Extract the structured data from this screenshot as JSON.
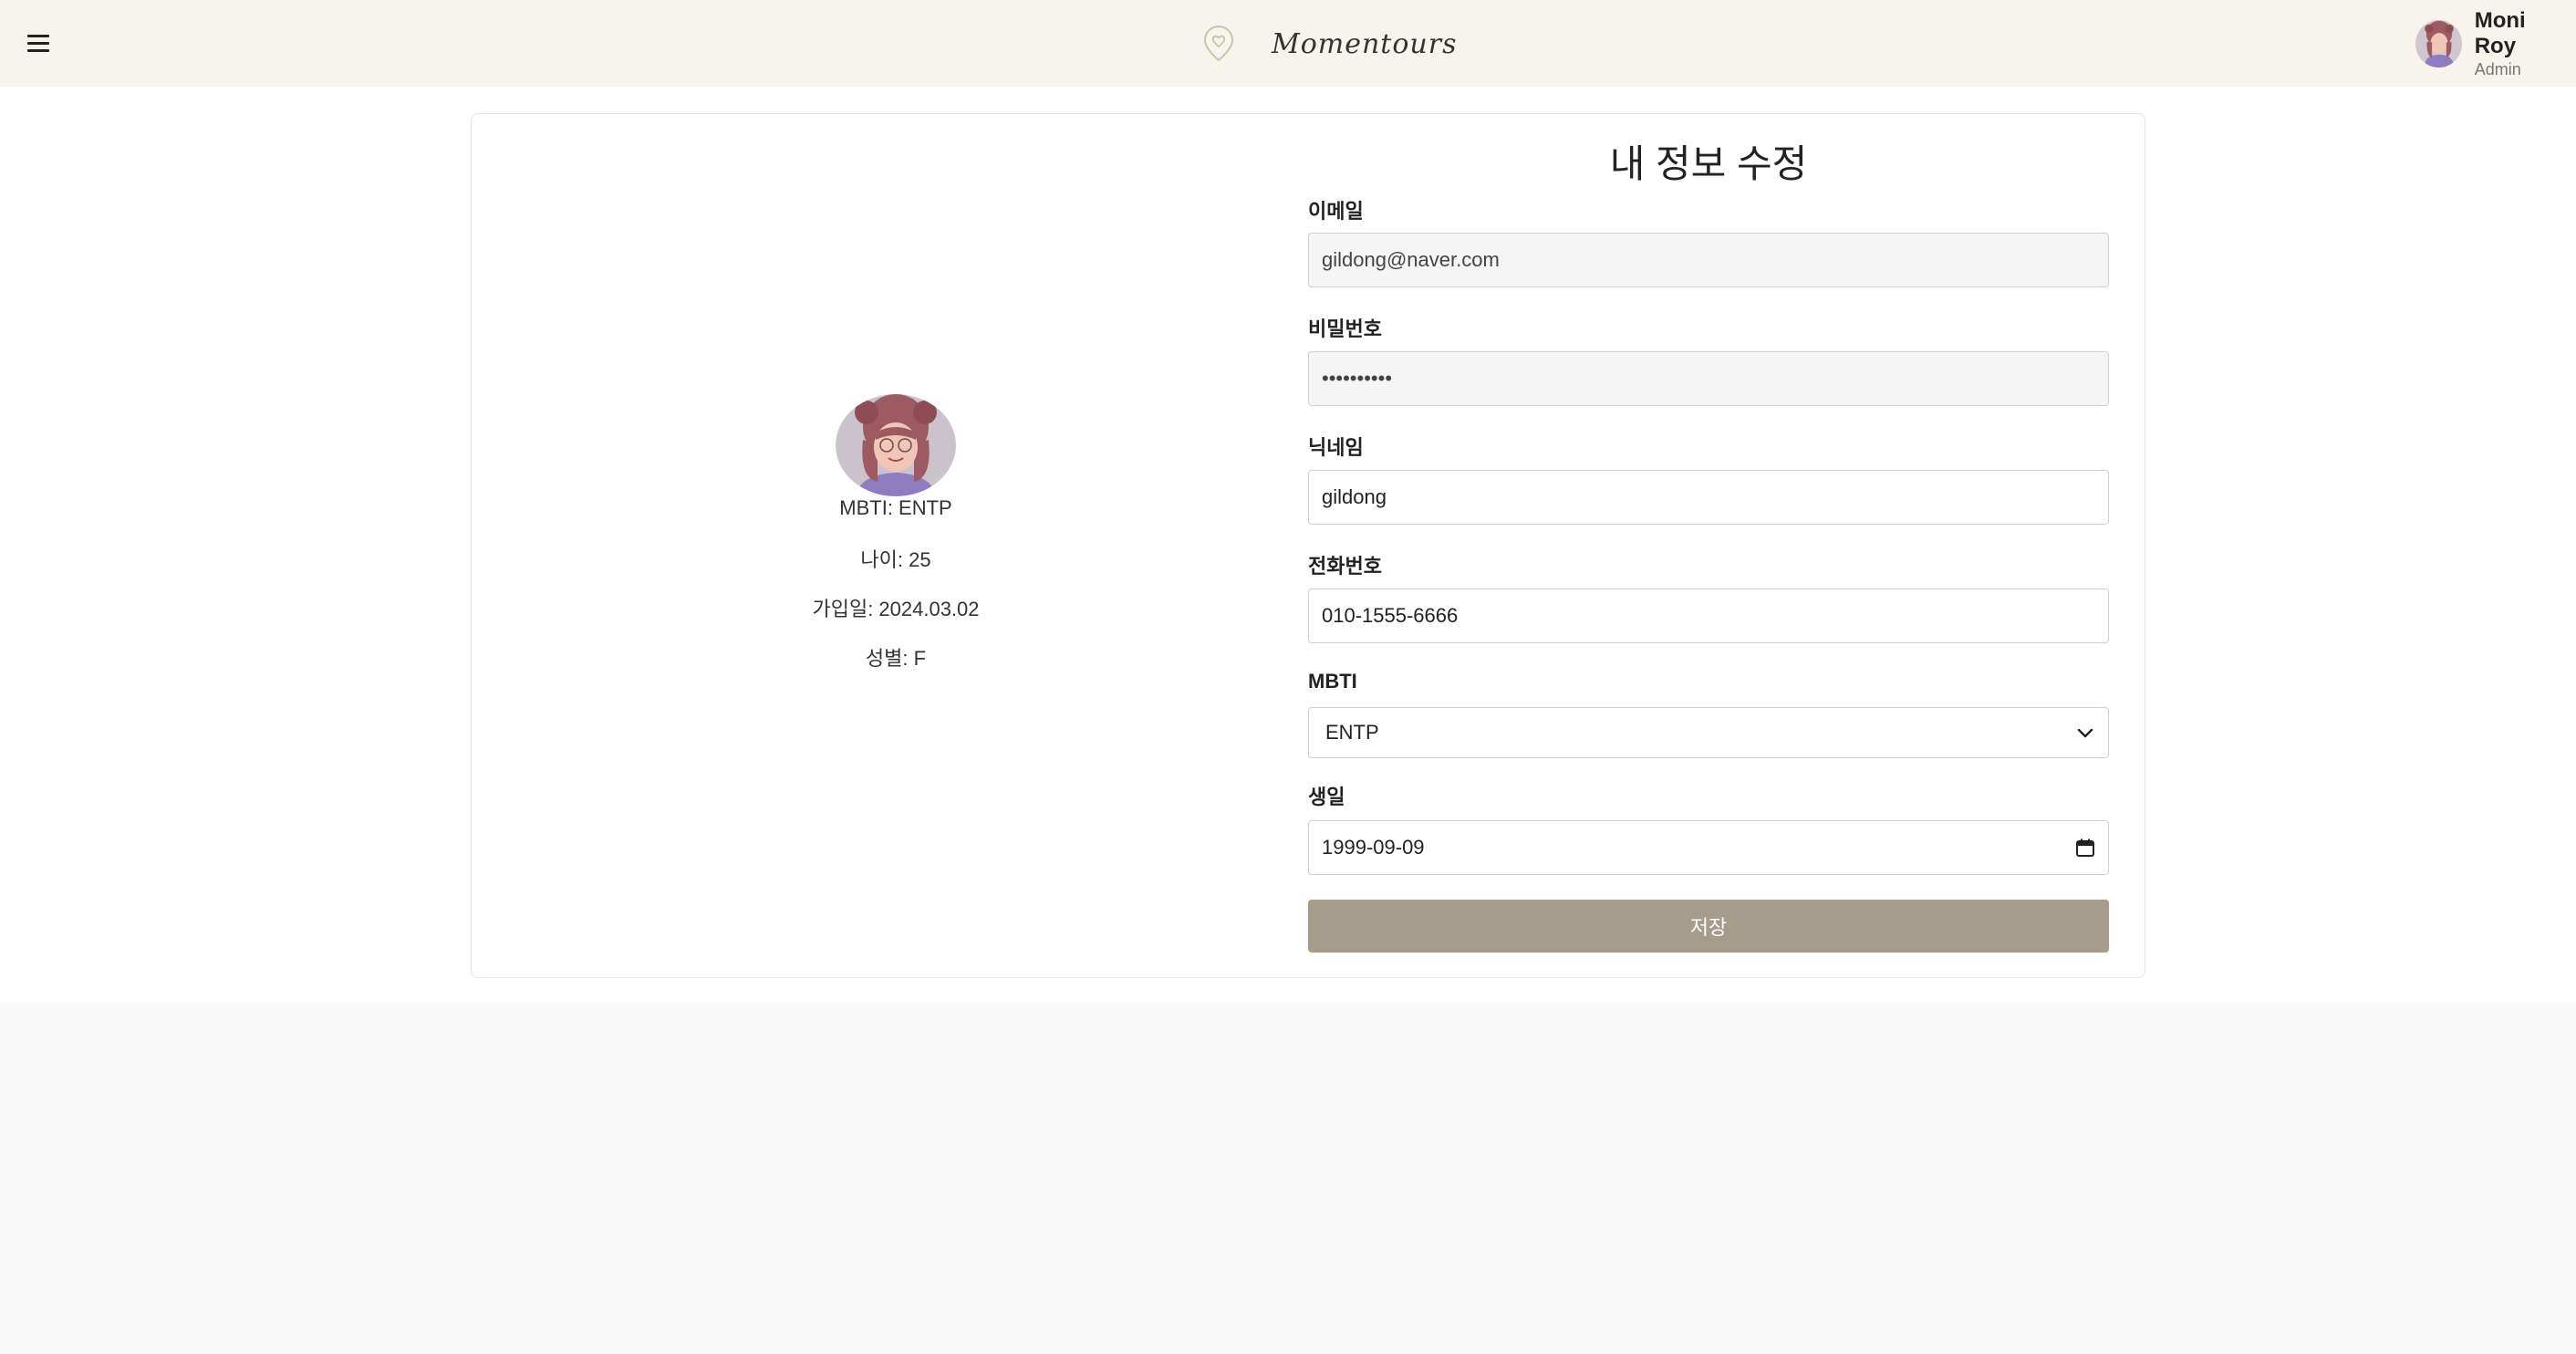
{
  "header": {
    "brand": "Momentours",
    "user": {
      "name": "Moni Roy",
      "role": "Admin"
    }
  },
  "profile": {
    "mbti": "MBTI: ENTP",
    "age": "나이: 25",
    "joined": "가입일: 2024.03.02",
    "gender": "성별: F"
  },
  "form": {
    "title": "내 정보 수정",
    "email": {
      "label": "이메일",
      "value": "gildong@naver.com"
    },
    "password": {
      "label": "비밀번호",
      "value": "••••••••••"
    },
    "nickname": {
      "label": "닉네임",
      "value": "gildong"
    },
    "phone": {
      "label": "전화번호",
      "value": "010-1555-6666"
    },
    "mbti": {
      "label": "MBTI",
      "value": "ENTP"
    },
    "birthday": {
      "label": "생일",
      "value": "1999-09-09"
    },
    "save_label": "저장"
  },
  "colors": {
    "header_bg": "#f6f4ec",
    "accent": "#a59c8a",
    "page_bg": "#f9f9f9"
  }
}
